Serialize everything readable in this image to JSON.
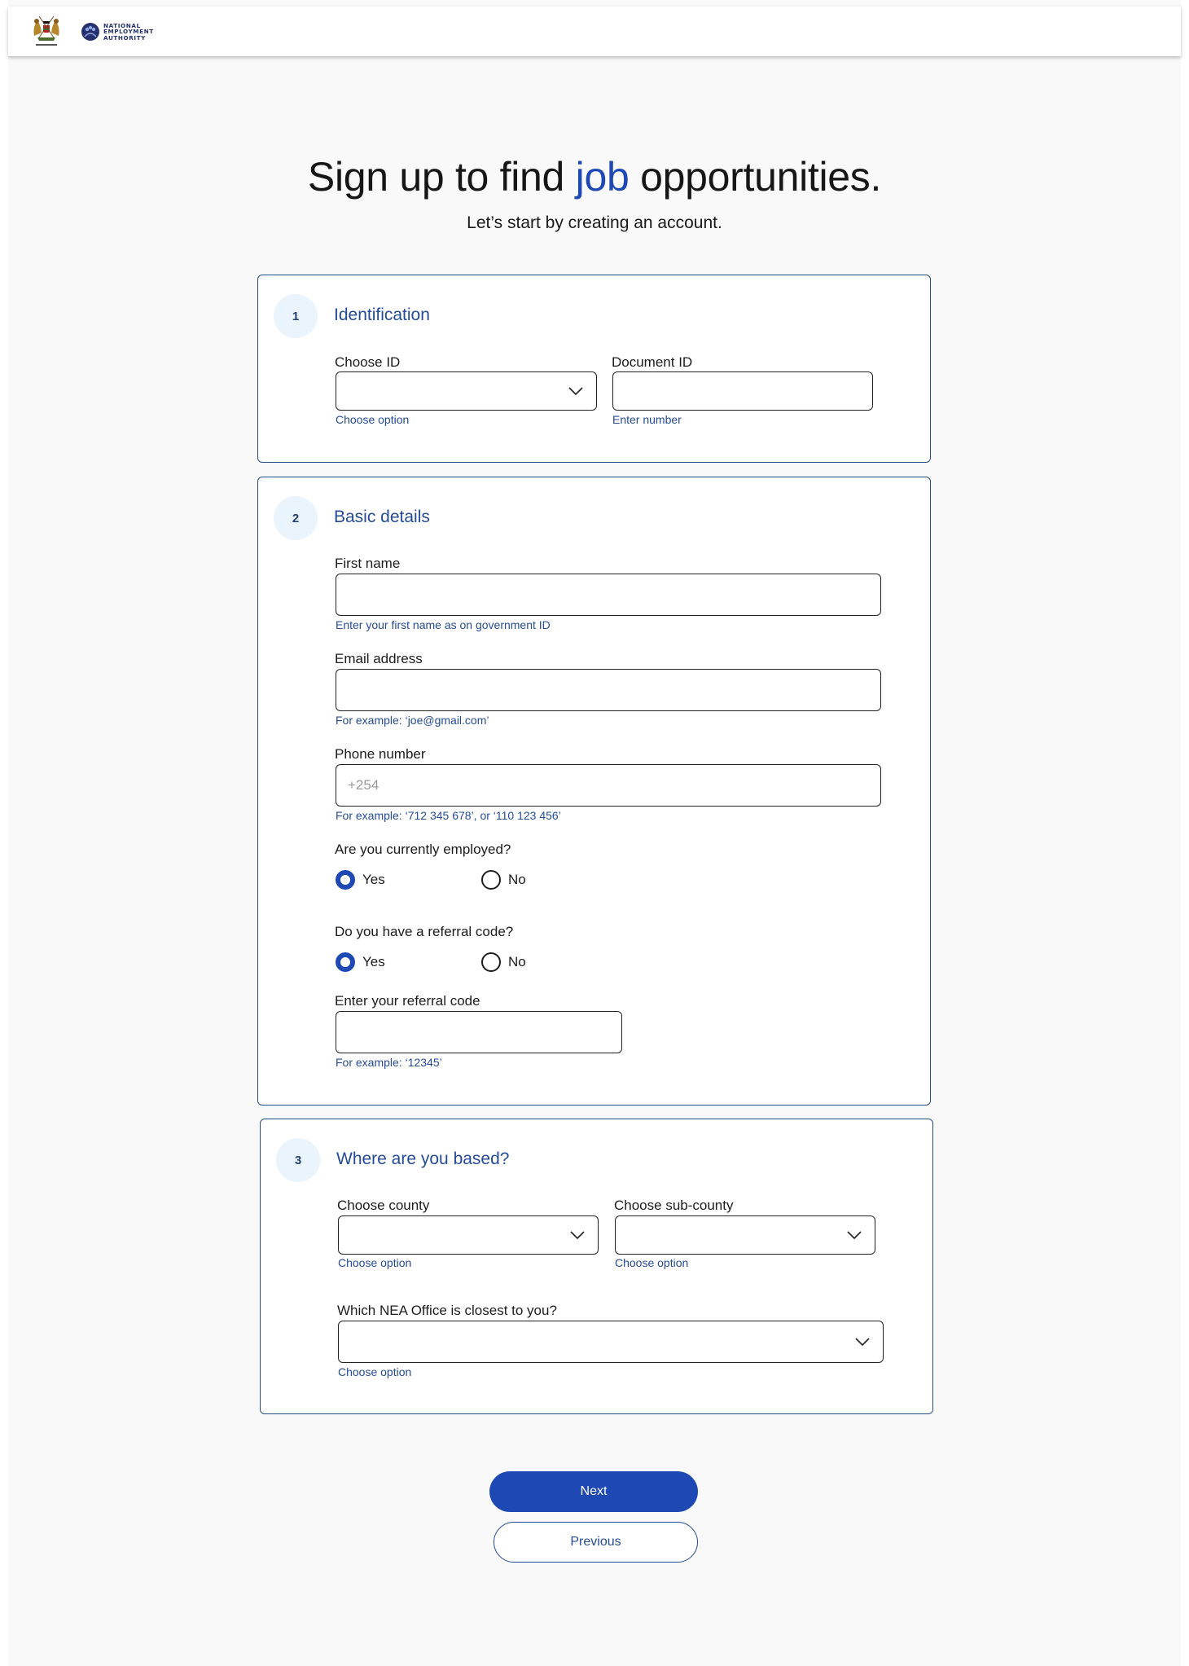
{
  "header": {
    "coat_of_arms_caption": "REPUBLIC OF KENYA",
    "org_logo_lines": [
      "NATIONAL",
      "EMPLOYMENT",
      "AUTHORITY"
    ]
  },
  "hero": {
    "title_before": "Sign up to find ",
    "title_accent": "job",
    "title_after": " opportunities.",
    "subtitle": "Let’s start by creating an account."
  },
  "sections": {
    "identification": {
      "step": "1",
      "title": "Identification",
      "choose_id": {
        "label": "Choose ID",
        "value": "",
        "hint": "Choose option"
      },
      "document_id": {
        "label": "Document ID",
        "value": "",
        "placeholder": "",
        "hint": "Enter number"
      }
    },
    "basic_details": {
      "step": "2",
      "title": "Basic details",
      "first_name": {
        "label": "First name",
        "value": "",
        "placeholder": "",
        "hint": "Enter your first name as on government ID"
      },
      "email": {
        "label": "Email address",
        "value": "",
        "placeholder": "",
        "hint": "For example: ‘joe@gmail.com’"
      },
      "phone": {
        "label": "Phone number",
        "value": "",
        "placeholder": "+254",
        "hint": "For example: ‘712 345 678’, or ‘110 123 456’"
      },
      "employed": {
        "question": "Are you currently employed?",
        "options": [
          {
            "label": "Yes",
            "selected": true
          },
          {
            "label": "No",
            "selected": false
          }
        ]
      },
      "referral": {
        "question": "Do you have a referral code?",
        "options": [
          {
            "label": "Yes",
            "selected": true
          },
          {
            "label": "No",
            "selected": false
          }
        ]
      },
      "referral_code": {
        "label": "Enter your referral code",
        "value": "",
        "placeholder": "",
        "hint": "For example: ‘12345’"
      }
    },
    "location": {
      "step": "3",
      "title": "Where are you based?",
      "county": {
        "label": "Choose county",
        "value": "",
        "hint": "Choose option"
      },
      "sub_county": {
        "label": "Choose sub-county",
        "value": "",
        "hint": "Choose option"
      },
      "nea_office": {
        "label": "Which NEA Office is closest to you?",
        "value": "",
        "hint": "Choose option"
      }
    }
  },
  "actions": {
    "next_label": "Next",
    "previous_label": "Previous"
  },
  "colors": {
    "accent": "#1e49b4",
    "section_title": "#254b98",
    "card_border": "#254e89",
    "step_circle_bg": "#e9f4fd",
    "page_bg": "#f9f9f9"
  }
}
